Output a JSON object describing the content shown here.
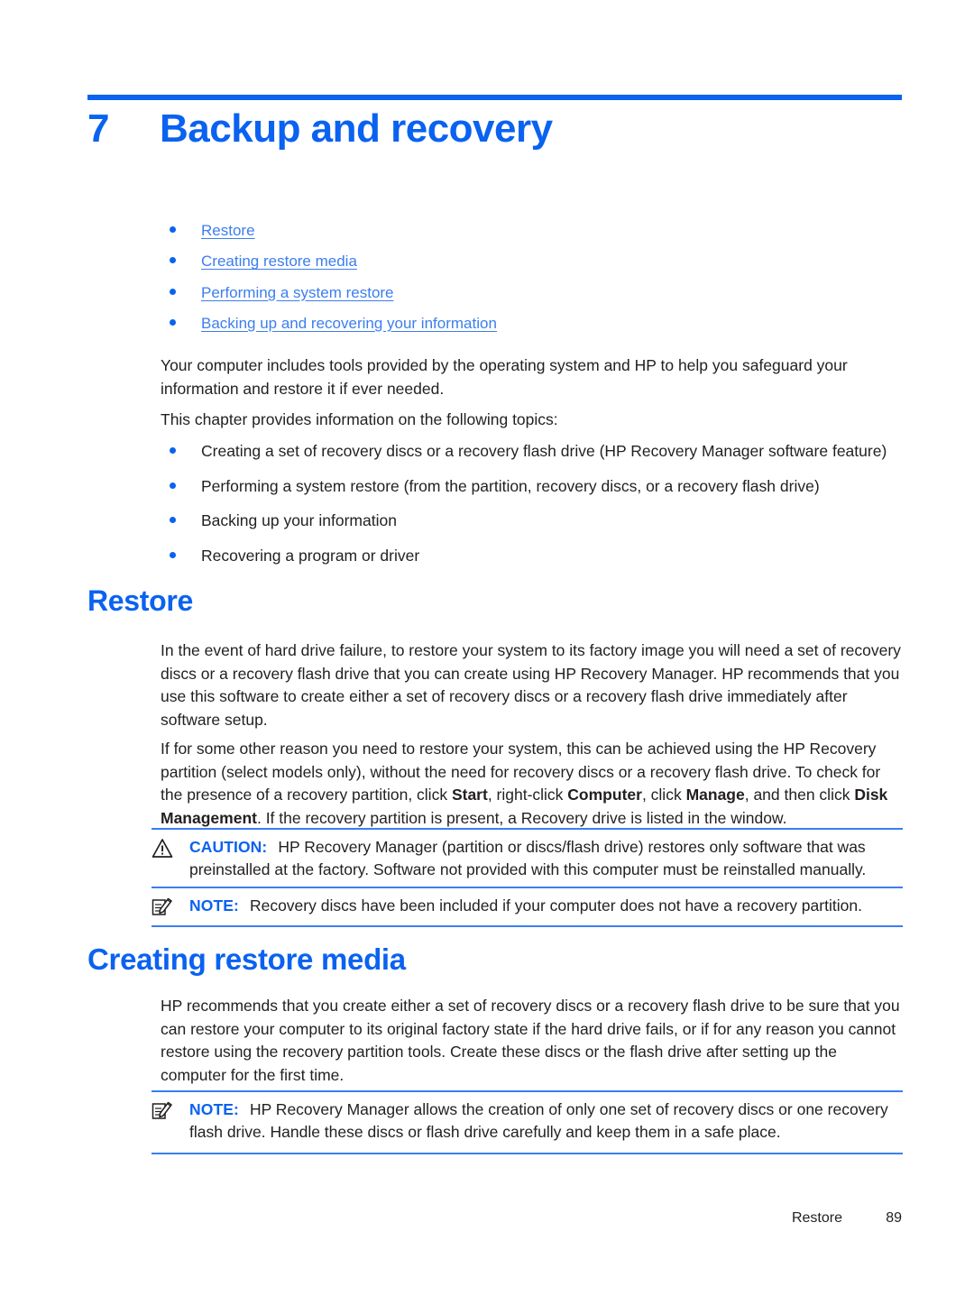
{
  "chapter": {
    "number": "7",
    "title": "Backup and recovery"
  },
  "links": [
    {
      "label": "Restore"
    },
    {
      "label": "Creating restore media"
    },
    {
      "label": "Performing a system restore"
    },
    {
      "label": "Backing up and recovering your information"
    }
  ],
  "intro": {
    "paragraph1": "Your computer includes tools provided by the operating system and HP to help you safeguard your information and restore it if ever needed.",
    "paragraph2": "This chapter provides information on the following topics:"
  },
  "topics": [
    {
      "label": "Creating a set of recovery discs or a recovery flash drive (HP Recovery Manager software feature)"
    },
    {
      "label": "Performing a system restore (from the partition, recovery discs, or a recovery flash drive)"
    },
    {
      "label": "Backing up your information"
    },
    {
      "label": "Recovering a program or driver"
    }
  ],
  "restore_section": {
    "heading": "Restore",
    "paragraph1": "In the event of hard drive failure, to restore your system to its factory image you will need a set of recovery discs or a recovery flash drive that you can create using HP Recovery Manager. HP recommends that you use this software to create either a set of recovery discs or a recovery flash drive immediately after software setup.",
    "paragraph2_part1": "If for some other reason you need to restore your system, this can be achieved using the HP Recovery partition (select models only), without the need for recovery discs or a recovery flash drive. To check for the presence of a recovery partition, click ",
    "paragraph2_bold1": "Start",
    "paragraph2_part2": ", right-click ",
    "paragraph2_bold2": "Computer",
    "paragraph2_part3": ", click ",
    "paragraph2_bold3": "Manage",
    "paragraph2_part4": ", and then click ",
    "paragraph2_bold4": "Disk Management",
    "paragraph2_part5": ". If the recovery partition is present, a Recovery drive is listed in the window.",
    "caution": {
      "icon": "warning-triangle-icon",
      "label": "CAUTION:",
      "text": "HP Recovery Manager (partition or discs/flash drive) restores only software that was preinstalled at the factory. Software not provided with this computer must be reinstalled manually."
    },
    "note": {
      "icon": "note-pencil-icon",
      "label": "NOTE:",
      "text": "Recovery discs have been included if your computer does not have a recovery partition."
    }
  },
  "creating_section": {
    "heading": "Creating restore media",
    "paragraph1": "HP recommends that you create either a set of recovery discs or a recovery flash drive to be sure that you can restore your computer to its original factory state if the hard drive fails, or if for any reason you cannot restore using the recovery partition tools. Create these discs or the flash drive after setting up the computer for the first time.",
    "note": {
      "icon": "note-pencil-icon",
      "label": "NOTE:",
      "text": "HP Recovery Manager allows the creation of only one set of recovery discs or one recovery flash drive. Handle these discs or flash drive carefully and keep them in a safe place."
    }
  },
  "footer": {
    "section": "Restore",
    "page_number": "89"
  },
  "colors": {
    "accent_blue": "#0a62f0",
    "link_blue": "#3b7ef0",
    "body_text": "#231f20"
  }
}
